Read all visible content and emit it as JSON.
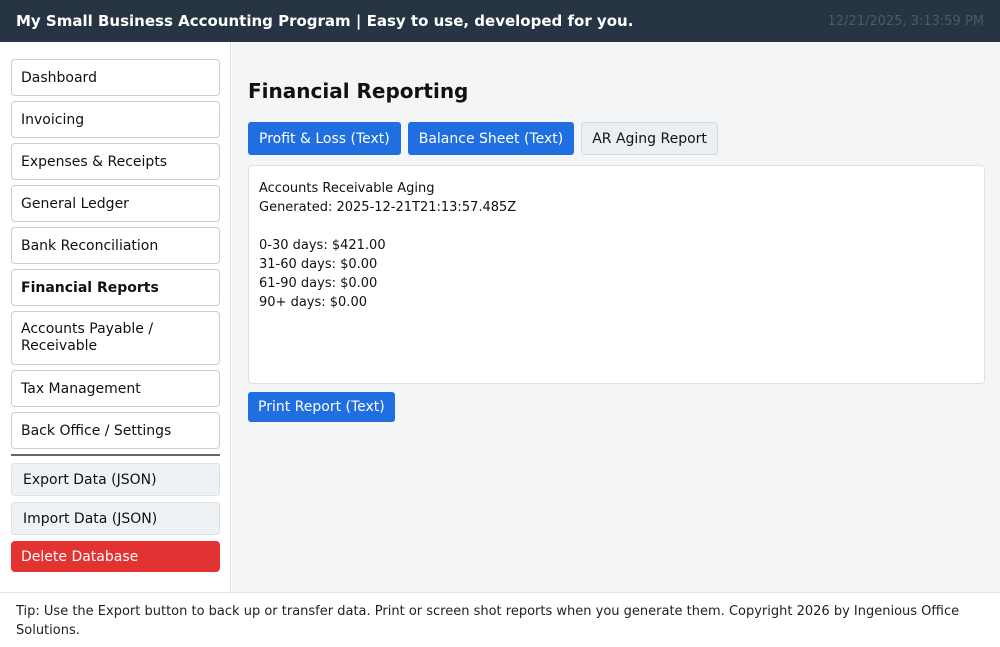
{
  "header": {
    "title": "My Small Business Accounting Program | Easy to use, developed for you.",
    "datetime": "12/21/2025, 3:13:59 PM"
  },
  "sidebar": {
    "items": [
      {
        "label": "Dashboard",
        "active": false
      },
      {
        "label": "Invoicing",
        "active": false
      },
      {
        "label": "Expenses & Receipts",
        "active": false
      },
      {
        "label": "General Ledger",
        "active": false
      },
      {
        "label": "Bank Reconciliation",
        "active": false
      },
      {
        "label": "Financial Reports",
        "active": true
      },
      {
        "label": "Accounts Payable / Receivable",
        "active": false
      },
      {
        "label": "Tax Management",
        "active": false
      },
      {
        "label": "Back Office / Settings",
        "active": false
      }
    ],
    "export_label": "Export Data (JSON)",
    "import_label": "Import Data (JSON)",
    "delete_label": "Delete Database"
  },
  "main": {
    "title": "Financial Reporting",
    "tabs": [
      {
        "label": "Profit & Loss (Text)"
      },
      {
        "label": "Balance Sheet (Text)"
      },
      {
        "label": "AR Aging Report"
      }
    ],
    "report": {
      "title": "Accounts Receivable Aging",
      "generated": "Generated: 2025-12-21T21:13:57.485Z",
      "lines": [
        "0-30 days: $421.00",
        "31-60 days: $0.00",
        "61-90 days: $0.00",
        "90+ days: $0.00"
      ]
    },
    "print_label": "Print Report (Text)"
  },
  "footer": {
    "tip": "Tip: Use the Export button to back up or transfer data. Print or screen shot reports when you generate them. Copyright 2026 by Ingenious Office Solutions."
  },
  "colors": {
    "header_bg": "#263443",
    "primary": "#1f6fe0",
    "danger": "#e23232",
    "main_bg": "#f3f5f7"
  }
}
